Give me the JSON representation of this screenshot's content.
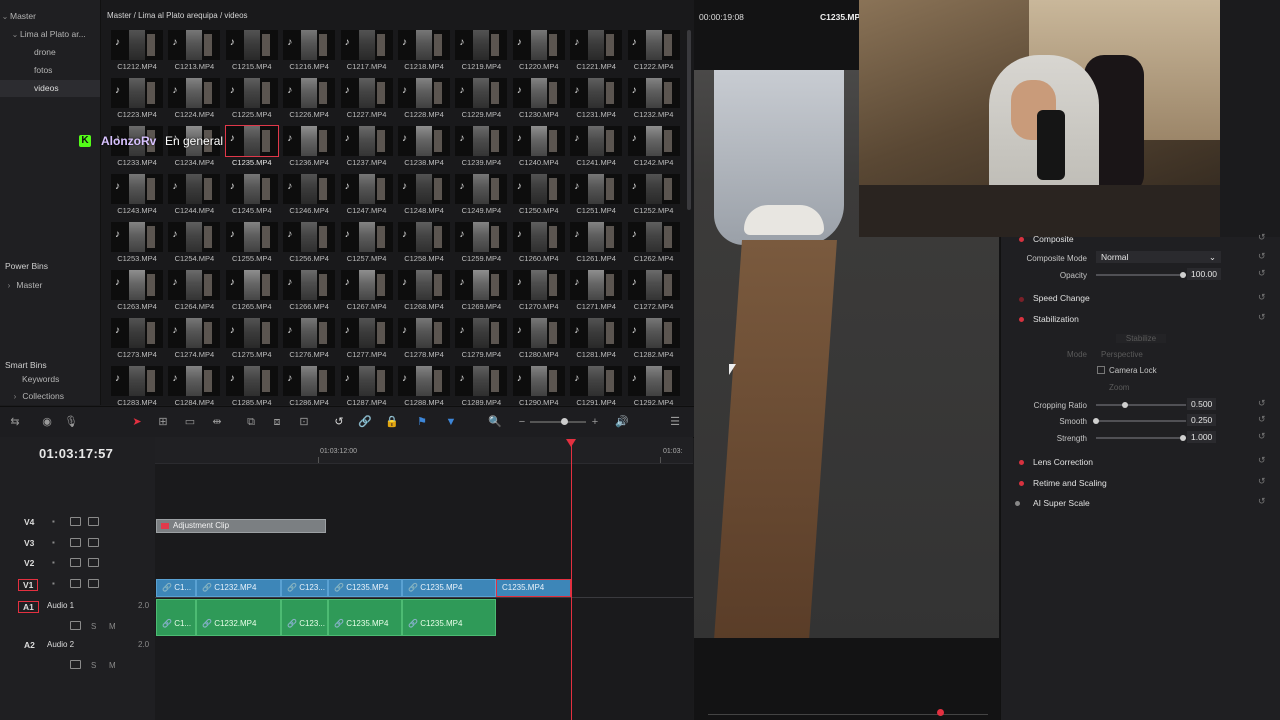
{
  "bins": {
    "master": "Master",
    "project_bin": "Lima al Plato ar...",
    "sub_bins": [
      "drone",
      "fotos",
      "videos"
    ],
    "selected": "videos",
    "power_bins_header": "Power Bins",
    "power_bins_master": "Master",
    "smart_bins_header": "Smart Bins",
    "smart_bins_items": [
      "Keywords",
      "Collections"
    ]
  },
  "media_pool": {
    "breadcrumb": "Master / Lima al Plato arequipa / videos",
    "rows": [
      [
        "C1212.MP4",
        "C1213.MP4",
        "C1215.MP4",
        "C1216.MP4",
        "C1217.MP4",
        "C1218.MP4",
        "C1219.MP4",
        "C1220.MP4",
        "C1221.MP4",
        "C1222.MP4"
      ],
      [
        "C1223.MP4",
        "C1224.MP4",
        "C1225.MP4",
        "C1226.MP4",
        "C1227.MP4",
        "C1228.MP4",
        "C1229.MP4",
        "C1230.MP4",
        "C1231.MP4",
        "C1232.MP4"
      ],
      [
        "C1233.MP4",
        "C1234.MP4",
        "C1235.MP4",
        "C1236.MP4",
        "C1237.MP4",
        "C1238.MP4",
        "C1239.MP4",
        "C1240.MP4",
        "C1241.MP4",
        "C1242.MP4"
      ],
      [
        "C1243.MP4",
        "C1244.MP4",
        "C1245.MP4",
        "C1246.MP4",
        "C1247.MP4",
        "C1248.MP4",
        "C1249.MP4",
        "C1250.MP4",
        "C1251.MP4",
        "C1252.MP4"
      ],
      [
        "C1253.MP4",
        "C1254.MP4",
        "C1255.MP4",
        "C1256.MP4",
        "C1257.MP4",
        "C1258.MP4",
        "C1259.MP4",
        "C1260.MP4",
        "C1261.MP4",
        "C1262.MP4"
      ],
      [
        "C1263.MP4",
        "C1264.MP4",
        "C1265.MP4",
        "C1266.MP4",
        "C1267.MP4",
        "C1268.MP4",
        "C1269.MP4",
        "C1270.MP4",
        "C1271.MP4",
        "C1272.MP4"
      ],
      [
        "C1273.MP4",
        "C1274.MP4",
        "C1275.MP4",
        "C1276.MP4",
        "C1277.MP4",
        "C1278.MP4",
        "C1279.MP4",
        "C1280.MP4",
        "C1281.MP4",
        "C1282.MP4"
      ],
      [
        "C1283.MP4",
        "C1284.MP4",
        "C1285.MP4",
        "C1286.MP4",
        "C1287.MP4",
        "C1288.MP4",
        "C1289.MP4",
        "C1290.MP4",
        "C1291.MP4",
        "C1292.MP4"
      ]
    ],
    "selected_clip": "C1235.MP4",
    "clip_icon": "music-note-icon"
  },
  "timeline": {
    "timecode": "01:03:17:57",
    "ruler_labels": [
      "01:03:12:00",
      "01:03:"
    ],
    "tracks": {
      "v4": "V4",
      "v3": "V3",
      "v2": "V2",
      "v1": "V1",
      "a1": "A1",
      "a1_name": "Audio 1",
      "a1_ch": "2.0",
      "a2": "A2",
      "a2_name": "Audio 2",
      "a2_ch": "2.0",
      "solo": "S",
      "mute": "M"
    },
    "adjustment_clip": "Adjustment Clip",
    "video_clips": [
      "C1...",
      "C1232.MP4",
      "C123...",
      "C1235.MP4",
      "C1235.MP4",
      "C1235.MP4"
    ],
    "audio_clips": [
      "C1...",
      "C1232.MP4",
      "C123...",
      "C1235.MP4",
      "C1235.MP4"
    ],
    "playhead_color": "#e33040",
    "video_clip_color": "#3d86b8",
    "audio_clip_color": "#2f9a58"
  },
  "viewer": {
    "timecode": "00:00:19:08",
    "clip_name": "C1235.MP4"
  },
  "inspector": {
    "composite": "Composite",
    "composite_mode_label": "Composite Mode",
    "composite_mode_value": "Normal",
    "opacity_label": "Opacity",
    "opacity_value": "100.00",
    "speed_change": "Speed Change",
    "stabilization": "Stabilization",
    "stabilize_button": "Stabilize",
    "mode_label": "Mode",
    "mode_value": "Perspective",
    "camera_lock": "Camera Lock",
    "zoom": "Zoom",
    "cropping_ratio_label": "Cropping Ratio",
    "cropping_ratio_value": "0.500",
    "smooth_label": "Smooth",
    "smooth_value": "0.250",
    "strength_label": "Strength",
    "strength_value": "1.000",
    "lens_correction": "Lens Correction",
    "retime_scaling": "Retime and Scaling",
    "ai_super_scale": "AI Super Scale"
  },
  "stream_chat": {
    "badge": "K",
    "username": "AlonzoRv",
    "message": "En general"
  }
}
